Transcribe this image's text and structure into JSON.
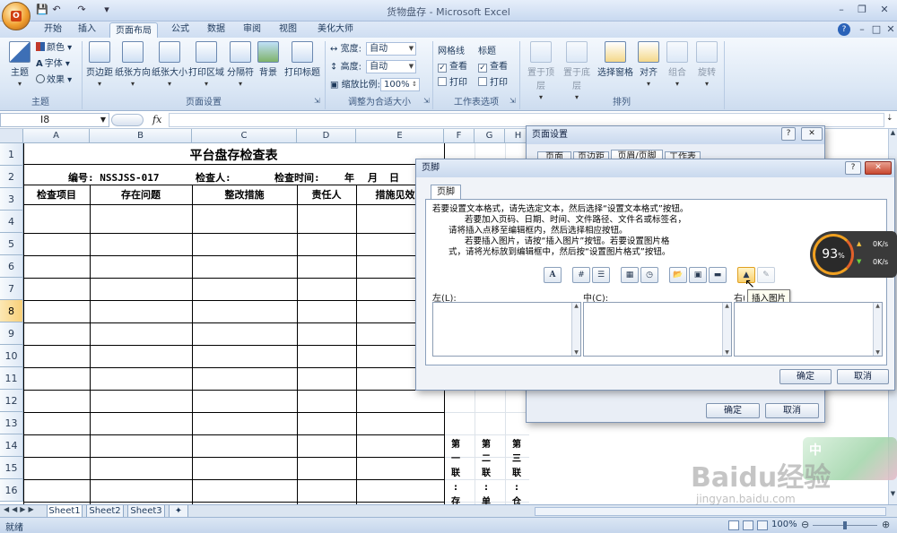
{
  "titlebar": {
    "title": "货物盘存 - Microsoft Excel",
    "office_button": "O",
    "quick_access": [
      "save-icon",
      "undo-icon",
      "redo-icon"
    ],
    "controls": [
      "–",
      "❐",
      "✕"
    ]
  },
  "tabs": [
    "开始",
    "插入",
    "页面布局",
    "公式",
    "数据",
    "审阅",
    "视图",
    "美化大师"
  ],
  "active_tab": "页面布局",
  "ribbon": {
    "theme": {
      "big_label": "主题",
      "items": [
        "颜色",
        "字体",
        "效果"
      ],
      "group": "主题"
    },
    "page_setup": {
      "buttons": [
        "页边距",
        "纸张方向",
        "纸张大小",
        "打印区域",
        "分隔符",
        "背景",
        "打印标题"
      ],
      "group": "页面设置"
    },
    "scale": {
      "width_label": "宽度:",
      "width_value": "自动",
      "height_label": "高度:",
      "height_value": "自动",
      "scale_label": "缩放比例:",
      "scale_value": "100%",
      "group": "调整为合适大小"
    },
    "sheet_options": {
      "gridlines": "网格线",
      "headings": "标题",
      "view": "查看",
      "print": "打印",
      "group": "工作表选项"
    },
    "arrange": {
      "buttons": [
        "置于顶层",
        "置于底层",
        "选择窗格",
        "对齐",
        "组合",
        "旋转"
      ],
      "group": "排列"
    }
  },
  "formula_bar": {
    "name_box": "I8",
    "fx": "fx"
  },
  "grid": {
    "columns": [
      "A",
      "B",
      "C",
      "D",
      "E",
      "F",
      "G",
      "H"
    ],
    "rows": [
      "1",
      "2",
      "3",
      "4",
      "5",
      "6",
      "7",
      "8",
      "9",
      "10",
      "11",
      "12",
      "13",
      "14",
      "15",
      "16"
    ],
    "selected_row": "8",
    "title": "平台盘存检查表",
    "row2": {
      "number_label": "编号: NSSJSS-017",
      "inspector": "检查人:",
      "time": "检查时间:",
      "year": "年",
      "month": "月",
      "day": "日"
    },
    "headers": [
      "检查项目",
      "存在问题",
      "整改措施",
      "责任人",
      "措施见效时"
    ],
    "vertical_notes": [
      "第一联:存根",
      "第二联:单证",
      "第三联:仓管"
    ]
  },
  "sheet_tabs": [
    "Sheet1",
    "Sheet2",
    "Sheet3"
  ],
  "status": {
    "left": "就绪",
    "zoom": "100%"
  },
  "page_setup_dialog": {
    "title": "页面设置",
    "tabs": [
      "页面",
      "页边距",
      "页眉/页脚",
      "工作表"
    ],
    "ok": "确定",
    "cancel": "取消"
  },
  "footer_dialog": {
    "title": "页脚",
    "tab": "页脚",
    "instructions": [
      "若要设置文本格式，请先选定文本，然后选择“设置文本格式”按钮。",
      "若要加入页码、日期、时间、文件路径、文件名或标签名，",
      "请将插入点移至编辑框内，然后选择相应按钮。",
      "若要插入图片，请按“插入图片”按钮。若要设置图片格",
      "式，请将光标放到编辑框中，然后按“设置图片格式”按钮。"
    ],
    "left_label": "左(L):",
    "center_label": "中(C):",
    "right_label": "右(R):",
    "tooltip": "插入图片",
    "ok": "确定",
    "cancel": "取消"
  },
  "gauge": {
    "percent": "93",
    "unit": "%",
    "up": "0K/s",
    "down": "0K/s"
  },
  "watermark": {
    "logo": "Baidu经验",
    "url": "jingyan.baidu.com",
    "ime": "中"
  }
}
